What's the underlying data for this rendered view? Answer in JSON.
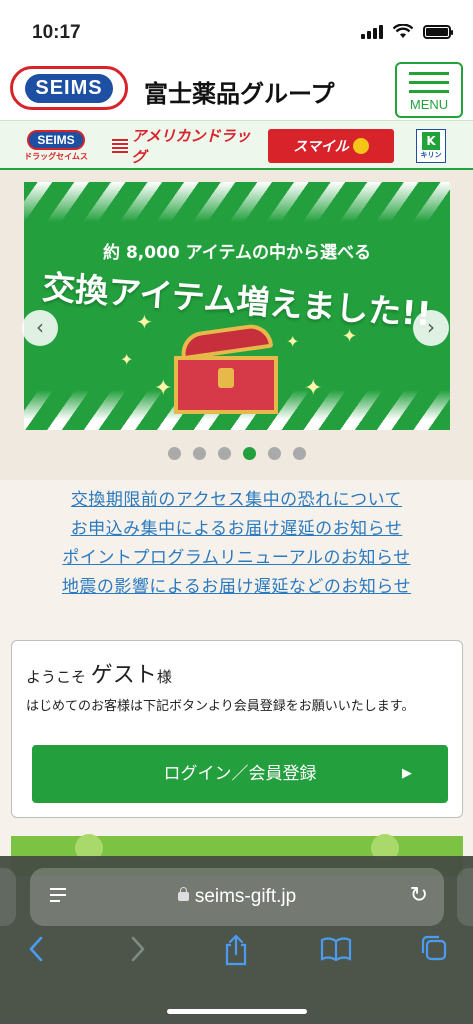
{
  "status": {
    "time": "10:17"
  },
  "header": {
    "logo_text": "SEIMS",
    "group_name": "富士薬品グループ",
    "menu_label": "MENU"
  },
  "brands": {
    "seims": {
      "logo": "SEIMS",
      "sub": "ドラッグセイムス"
    },
    "america": {
      "name": "アメリカンドラッグ"
    },
    "smile": {
      "name": "スマイル"
    },
    "kirin": {
      "mark": "K",
      "sub": "キリン"
    }
  },
  "banner": {
    "subtitle": "約 8,000 アイテムの中から選べる",
    "title": "交換アイテム増えました!!",
    "slide_count": 6,
    "active_slide": 4
  },
  "news": [
    "交換期限前のアクセス集中の恐れについて",
    "お申込み集中によるお届け遅延のお知らせ",
    "ポイントプログラムリニューアルのお知らせ",
    "地震の影響によるお届け遅延などのお知らせ"
  ],
  "welcome": {
    "prefix": "ようこそ",
    "guest": "ゲスト",
    "suffix": "様",
    "message": "はじめてのお客様は下記ボタンより会員登録をお願いいたします。",
    "login_button": "ログイン／会員登録"
  },
  "browser": {
    "url": "seims-gift.jp",
    "icons": [
      "back-icon",
      "forward-icon",
      "share-icon",
      "bookmarks-icon",
      "tabs-icon"
    ]
  },
  "colors": {
    "brand_green": "#23a03d",
    "link_blue": "#2a7ac0",
    "seims_red": "#d8232a",
    "seims_blue": "#1d4fa3"
  }
}
